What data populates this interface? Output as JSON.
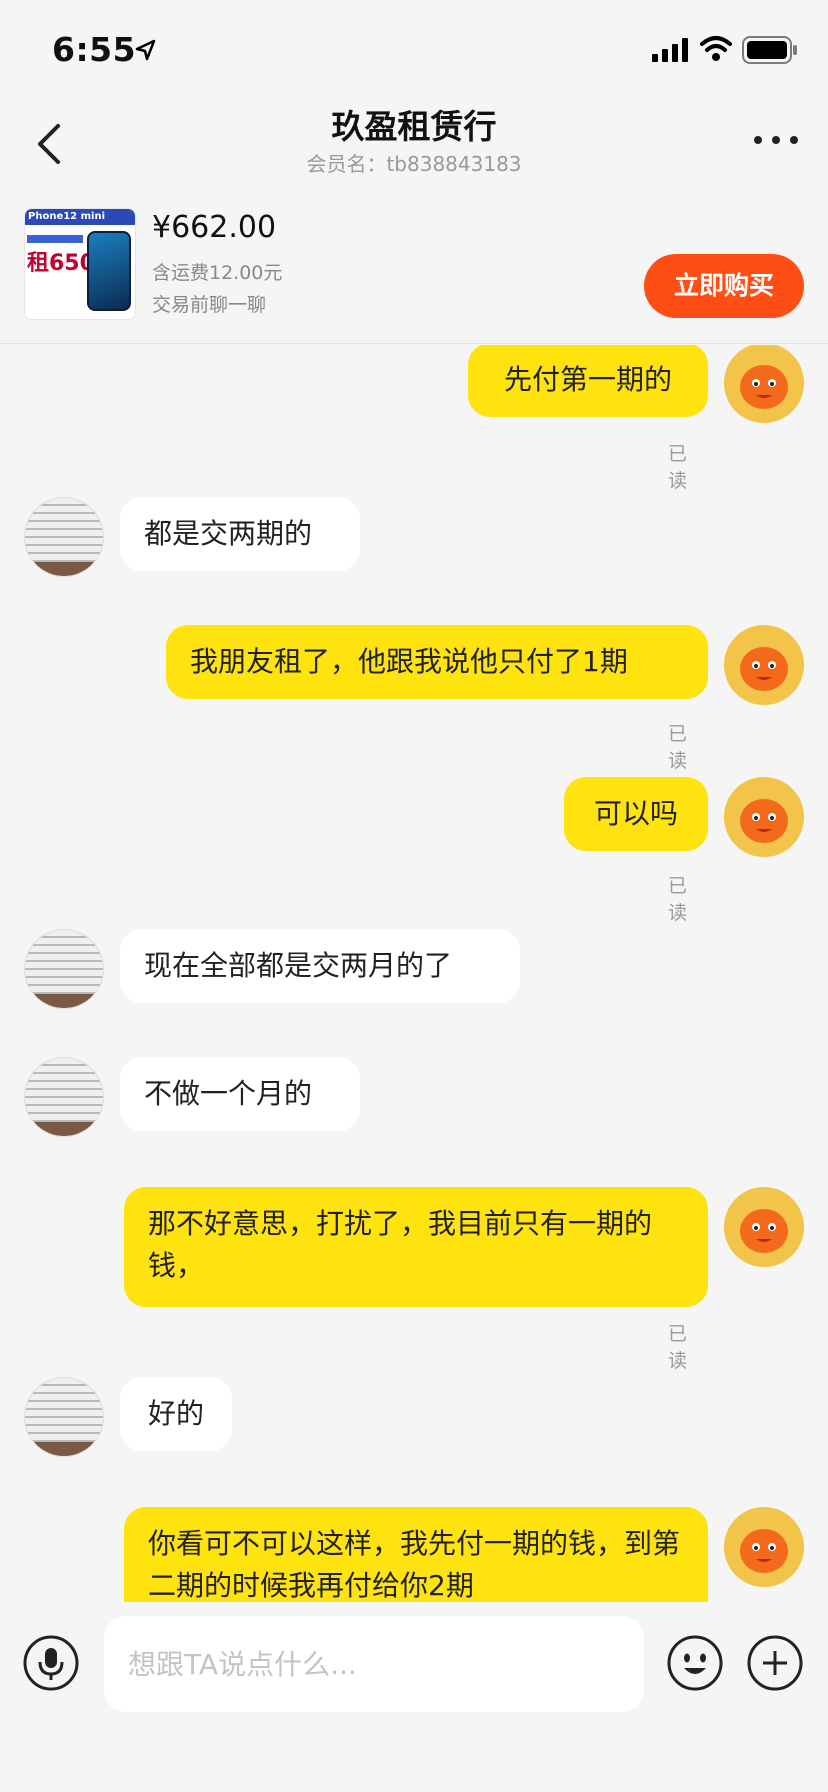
{
  "status_bar": {
    "time": "6:55",
    "location_icon": "location-arrow-icon",
    "signal_icon": "signal-icon",
    "wifi_icon": "wifi-icon",
    "battery_icon": "battery-icon"
  },
  "header": {
    "title": "玖盈租赁行",
    "subtitle": "会员名：tb838843183",
    "back_icon": "chevron-left-icon",
    "more_icon": "more-dots-icon"
  },
  "product": {
    "thumb_title": "Phone12  mini",
    "thumb_rent": "租650",
    "price": "¥662.00",
    "shipping": "含运费12.00元",
    "chat_hint": "交易前聊一聊",
    "buy_label": "立即购买"
  },
  "messages": [
    {
      "side": "self",
      "text": "先付第一期的",
      "read": "已读"
    },
    {
      "side": "other",
      "text": "都是交两期的"
    },
    {
      "side": "self",
      "text": "我朋友租了，他跟我说他只付了1期",
      "read": "已读"
    },
    {
      "side": "self",
      "text": "可以吗",
      "read": "已读"
    },
    {
      "side": "other",
      "text": "现在全部都是交两月的了"
    },
    {
      "side": "other",
      "text": "不做一个月的"
    },
    {
      "side": "self",
      "text": "那不好意思，打扰了，我目前只有一期的钱，",
      "read": "已读"
    },
    {
      "side": "other",
      "text": "好的"
    },
    {
      "side": "self",
      "text": "你看可不可以这样，我先付一期的钱，到第二期的时候我再付给你2期"
    }
  ],
  "input_bar": {
    "placeholder": "想跟TA说点什么...",
    "mic_icon": "microphone-icon",
    "emoji_icon": "emoji-icon",
    "plus_icon": "plus-circle-icon"
  },
  "colors": {
    "self_bubble": "#ffe30f",
    "other_bubble": "#ffffff",
    "buy_button": "#ff4d16",
    "background": "#f5f5f5"
  }
}
